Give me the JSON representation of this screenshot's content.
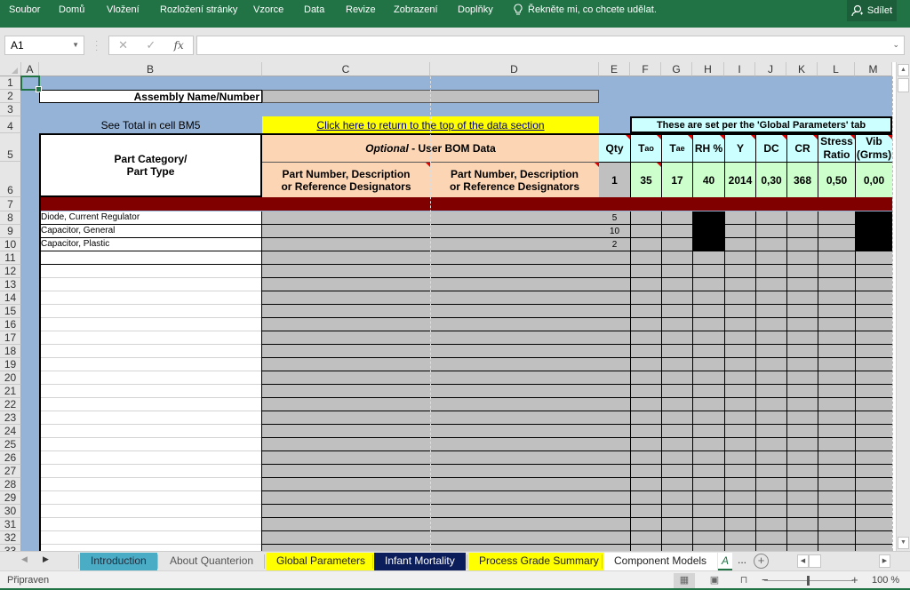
{
  "ribbon": {
    "tabs": [
      "Soubor",
      "Domů",
      "Vložení",
      "Rozložení stránky",
      "Vzorce",
      "Data",
      "Revize",
      "Zobrazení",
      "Doplňky"
    ],
    "tell_me": "Řekněte mi, co chcete udělat.",
    "share": "Sdílet"
  },
  "formula_bar": {
    "name_box": "A1",
    "cancel_icon": "✕",
    "enter_icon": "✓",
    "fx_label": "fx",
    "formula": ""
  },
  "columns": [
    "A",
    "B",
    "C",
    "D",
    "E",
    "F",
    "G",
    "H",
    "I",
    "J",
    "K",
    "L",
    "M"
  ],
  "rows": [
    "1",
    "2",
    "3",
    "4",
    "5",
    "6",
    "7",
    "8",
    "9",
    "10",
    "11",
    "12",
    "13",
    "14",
    "15",
    "16",
    "17",
    "18",
    "19",
    "20",
    "21",
    "22",
    "23",
    "24",
    "25",
    "26",
    "27",
    "28",
    "29",
    "30",
    "31",
    "32",
    "33"
  ],
  "sheet": {
    "assembly_label": "Assembly Name/Number",
    "assembly_value": "",
    "see_total": "See Total in cell BM5",
    "return_link": "Click here to return to the top of the data section",
    "global_note": "These are set per the 'Global Parameters' tab",
    "part_category": "Part Category/",
    "part_type": "Part Type",
    "optional_italic": "Optional",
    "optional_rest": " - User BOM Data",
    "part_number_c": "Part Number, Description or Reference Designators",
    "part_number_d": "Part Number, Description or Reference Designators",
    "param_headers": [
      {
        "main": "Qty",
        "sub": ""
      },
      {
        "main": "T",
        "sub": "ao"
      },
      {
        "main": "T",
        "sub": "ae"
      },
      {
        "main": "RH %",
        "sub": ""
      },
      {
        "main": "Y",
        "sub": ""
      },
      {
        "main": "DC",
        "sub": ""
      },
      {
        "main": "CR",
        "sub": ""
      },
      {
        "main": "Stress Ratio",
        "sub": ""
      },
      {
        "main": "Vib (Grms)",
        "sub": ""
      }
    ],
    "param_values": [
      "1",
      "35",
      "17",
      "40",
      "2014",
      "0,30",
      "368",
      "0,50",
      "0,00"
    ],
    "parts": [
      {
        "type": "Diode, Current Regulator",
        "qty": "5"
      },
      {
        "type": "Capacitor, General",
        "qty": "10"
      },
      {
        "type": "Capacitor, Plastic",
        "qty": "2"
      }
    ]
  },
  "sheet_tabs": [
    {
      "label": "Introduction",
      "bg": "#4bacc6",
      "color": "#1f2d3d"
    },
    {
      "label": "About Quanterion",
      "bg": "#e6e6e6",
      "color": "#555555"
    },
    {
      "label": "Global Parameters",
      "bg": "#ffff00",
      "color": "#222222"
    },
    {
      "label": "Infant Mortality",
      "bg": "#0c1d5c",
      "color": "#ffffff"
    },
    {
      "label": "Process Grade Summary",
      "bg": "#ffff00",
      "color": "#222222"
    },
    {
      "label": "Component Models",
      "bg": "#ffffff",
      "color": "#222222"
    },
    {
      "label": "A",
      "bg": "#ffffff",
      "color": "#217346"
    }
  ],
  "sheet_more": "...",
  "status": {
    "ready": "Připraven",
    "zoom": "100 %"
  }
}
